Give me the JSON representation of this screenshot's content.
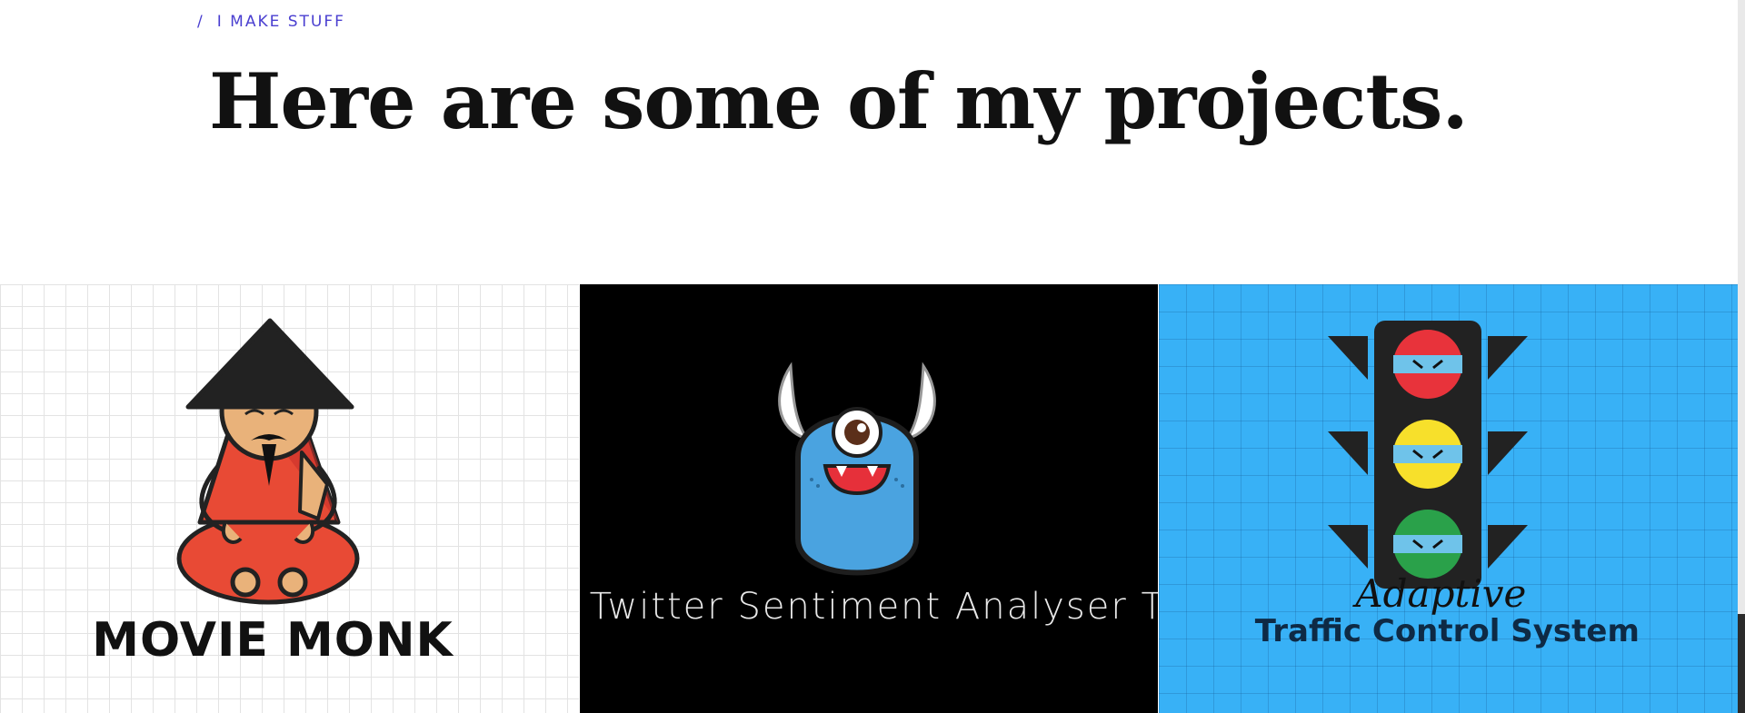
{
  "breadcrumb": {
    "separator": "/",
    "label": "I MAKE STUFF"
  },
  "hero": {
    "title": "Here are some of my projects."
  },
  "projects": [
    {
      "title": "MOVIE MONK",
      "image": "monk-illustration"
    },
    {
      "title": "Twitter Sentiment Analyser  T",
      "image": "monster-illustration"
    },
    {
      "title_line1": "Adaptive",
      "title_line2": "Traffic Control System",
      "image": "traffic-light-illustration"
    }
  ],
  "colors": {
    "accent": "#4a3fd0",
    "monk_card_bg": "#ffffff",
    "twitter_card_bg": "#000000",
    "traffic_card_bg": "#38b1f6",
    "monk_robe": "#e84a35",
    "monster_body": "#4aa3e0"
  }
}
